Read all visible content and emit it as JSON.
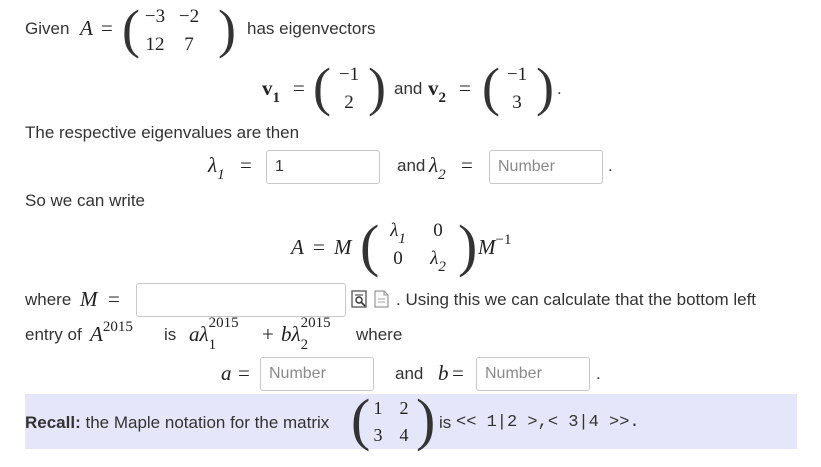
{
  "line1": {
    "given": "Given",
    "A": "A",
    "eq": "=",
    "has_eigenvectors": "has eigenvectors"
  },
  "matrixA": [
    "−3",
    "−2",
    "12",
    "7"
  ],
  "eigvecs": {
    "v": "v",
    "sub1": "1",
    "sub2": "2",
    "eq": "=",
    "and": "and",
    "v1": [
      "−1",
      "2"
    ],
    "v2": [
      "−1",
      "3"
    ],
    "dot": "."
  },
  "eigvals": {
    "text": "The respective eigenvalues are then",
    "lambda": "λ",
    "sub1": "1",
    "sub2": "2",
    "eq": "=",
    "and": "and",
    "dot": ".",
    "lambda1_value": "1",
    "lambda2_placeholder": "Number"
  },
  "write": {
    "text": "So we can write",
    "A": "A",
    "eq": "=",
    "M": "M",
    "Minv": "M",
    "inv": "−1",
    "diag": {
      "a11_sym": "λ",
      "a11_sub": "1",
      "a12": "0",
      "a21": "0",
      "a22_sym": "λ",
      "a22_sub": "2"
    }
  },
  "where": {
    "where": "where",
    "M": "M",
    "eq": "=",
    "M_value": "",
    "tail": ". Using this we can calculate that the bottom left",
    "entry_of": "entry of",
    "A": "A",
    "exp": "2015",
    "is": "is",
    "a": "a",
    "b": "b",
    "lambda": "λ",
    "sub1": "1",
    "sub2": "2",
    "plus": "+",
    "where2": "where"
  },
  "ab": {
    "a": "a",
    "eq": "=",
    "and": "and",
    "b": "b",
    "dot": ".",
    "a_placeholder": "Number",
    "b_placeholder": "Number"
  },
  "recall": {
    "label": "Recall:",
    "text": "the Maple notation for the matrix",
    "matrix": [
      "1",
      "2",
      "3",
      "4"
    ],
    "is": "is",
    "maple": "<< 1|2 >,< 3|4 >>."
  },
  "icons": [
    "preview-matrix-icon",
    "matrix-help-icon"
  ],
  "colors": {
    "recall_bg": "#e6e6fa",
    "input_border": "#c8c8c8",
    "text": "#333333"
  }
}
